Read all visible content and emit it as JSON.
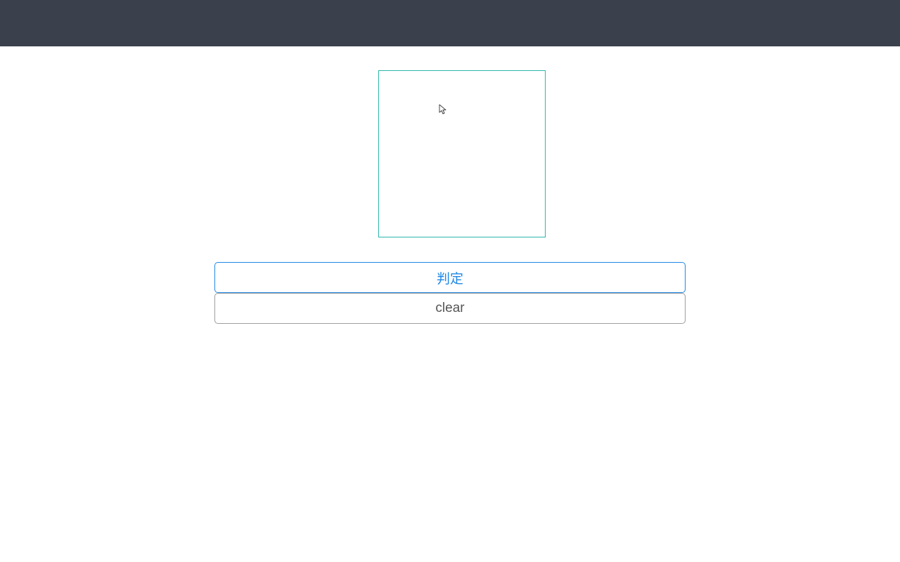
{
  "buttons": {
    "judge_label": "判定",
    "clear_label": "clear"
  }
}
